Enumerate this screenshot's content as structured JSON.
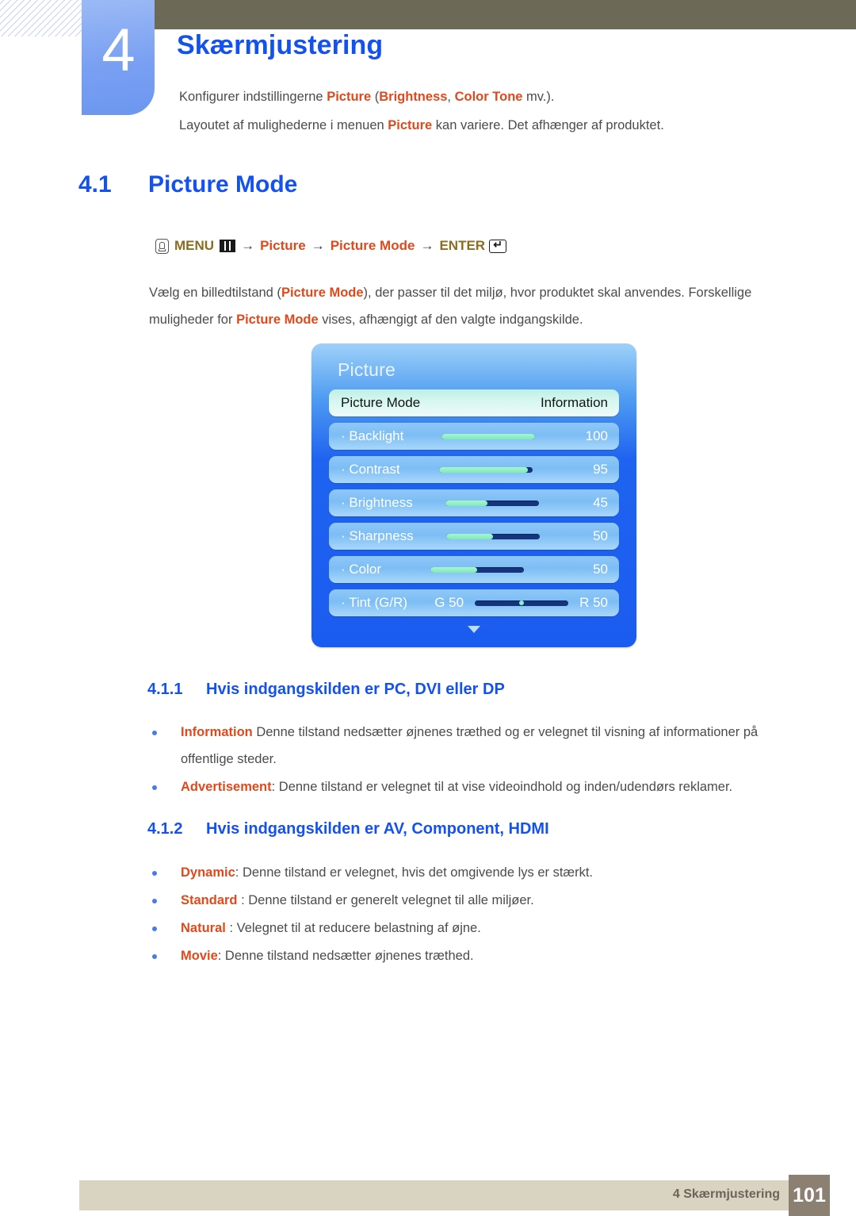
{
  "chapter": {
    "number": "4",
    "title": "Skærmjustering",
    "intro_lines": [
      {
        "parts": [
          {
            "t": "Konfigurer indstillingerne ",
            "style": "plain"
          },
          {
            "t": "Picture",
            "style": "kw"
          },
          {
            "t": " (",
            "style": "plain"
          },
          {
            "t": "Brightness",
            "style": "kw"
          },
          {
            "t": ", ",
            "style": "plain"
          },
          {
            "t": "Color Tone",
            "style": "kw"
          },
          {
            "t": " mv.).",
            "style": "plain"
          }
        ]
      },
      {
        "parts": [
          {
            "t": "Layoutet af mulighederne i menuen ",
            "style": "plain"
          },
          {
            "t": "Picture",
            "style": "kw"
          },
          {
            "t": " kan variere. Det afhænger af produktet.",
            "style": "plain"
          }
        ]
      }
    ]
  },
  "section": {
    "number": "4.1",
    "title": "Picture Mode"
  },
  "menu_path": {
    "hand_icon": "hand-press-icon",
    "menu_label": "MENU",
    "menu_icon": "menu-grid-icon",
    "arrow": "→",
    "item1": "Picture",
    "item2": "Picture Mode",
    "enter_label": "ENTER",
    "enter_icon": "enter-key-icon"
  },
  "body_paragraph": {
    "parts": [
      {
        "t": "Vælg en billedtilstand (",
        "style": "plain"
      },
      {
        "t": "Picture Mode",
        "style": "kw"
      },
      {
        "t": "), der passer til det miljø, hvor produktet skal anvendes. Forskellige muligheder for ",
        "style": "plain"
      },
      {
        "t": "Picture Mode",
        "style": "kw"
      },
      {
        "t": " vises, afhængigt af den valgte indgangskilde.",
        "style": "plain"
      }
    ]
  },
  "osd": {
    "title": "Picture",
    "rows": [
      {
        "label": "Picture Mode",
        "value": "Information",
        "selected": true,
        "slider": null
      },
      {
        "label": "· Backlight",
        "value": "100",
        "selected": false,
        "slider": {
          "type": "fill",
          "percent": 100
        }
      },
      {
        "label": "· Contrast",
        "value": "95",
        "selected": false,
        "slider": {
          "type": "fill",
          "percent": 95
        }
      },
      {
        "label": "· Brightness",
        "value": "45",
        "selected": false,
        "slider": {
          "type": "fill",
          "percent": 45
        }
      },
      {
        "label": "· Sharpness",
        "value": "50",
        "selected": false,
        "slider": {
          "type": "fill",
          "percent": 50
        }
      },
      {
        "label": "· Color",
        "value": "50",
        "selected": false,
        "slider": {
          "type": "fill",
          "percent": 50
        }
      },
      {
        "label": "· Tint (G/R)",
        "value": null,
        "selected": false,
        "slider": {
          "type": "center"
        },
        "tint_left": "G 50",
        "tint_right": "R 50"
      }
    ],
    "scroll_down_icon": "chevron-down-icon"
  },
  "subsections": [
    {
      "number": "4.1.1",
      "title": "Hvis indgangskilden er PC, DVI eller DP",
      "bullets": [
        {
          "parts": [
            {
              "t": "Information",
              "style": "kw"
            },
            {
              "t": " Denne tilstand nedsætter øjnenes træthed og er velegnet til visning af informationer på offentlige steder.",
              "style": "plain"
            }
          ]
        },
        {
          "parts": [
            {
              "t": "Advertisement",
              "style": "kw"
            },
            {
              "t": ": Denne tilstand er velegnet til at vise videoindhold og inden/udendørs reklamer.",
              "style": "plain"
            }
          ]
        }
      ]
    },
    {
      "number": "4.1.2",
      "title": "Hvis indgangskilden er AV, Component, HDMI",
      "bullets": [
        {
          "parts": [
            {
              "t": "Dynamic",
              "style": "kw"
            },
            {
              "t": ": Denne tilstand er velegnet, hvis det omgivende lys er stærkt.",
              "style": "plain"
            }
          ]
        },
        {
          "parts": [
            {
              "t": "Standard",
              "style": "kw"
            },
            {
              "t": " : Denne tilstand er generelt velegnet til alle miljøer.",
              "style": "plain"
            }
          ]
        },
        {
          "parts": [
            {
              "t": "Natural",
              "style": "kw"
            },
            {
              "t": " : Velegnet til at reducere belastning af øjne.",
              "style": "plain"
            }
          ]
        },
        {
          "parts": [
            {
              "t": "Movie",
              "style": "kw"
            },
            {
              "t": ": Denne tilstand nedsætter øjnenes træthed.",
              "style": "plain"
            }
          ]
        }
      ]
    }
  ],
  "footer": {
    "label": "4 Skærmjustering",
    "page_number": "101"
  },
  "colors": {
    "heading_blue": "#1452f0",
    "keyword_orange": "#e0491b",
    "path_olive": "#8a6d1e",
    "olive_bar": "#6c6a56",
    "footer_bar": "#d9d4c2",
    "page_box": "#8c8072",
    "osd_blue": "#1b5cf0",
    "osd_selected_mint": "#d8f7ef",
    "slider_fill": "#8cf0c4",
    "slider_track": "#16347e"
  }
}
